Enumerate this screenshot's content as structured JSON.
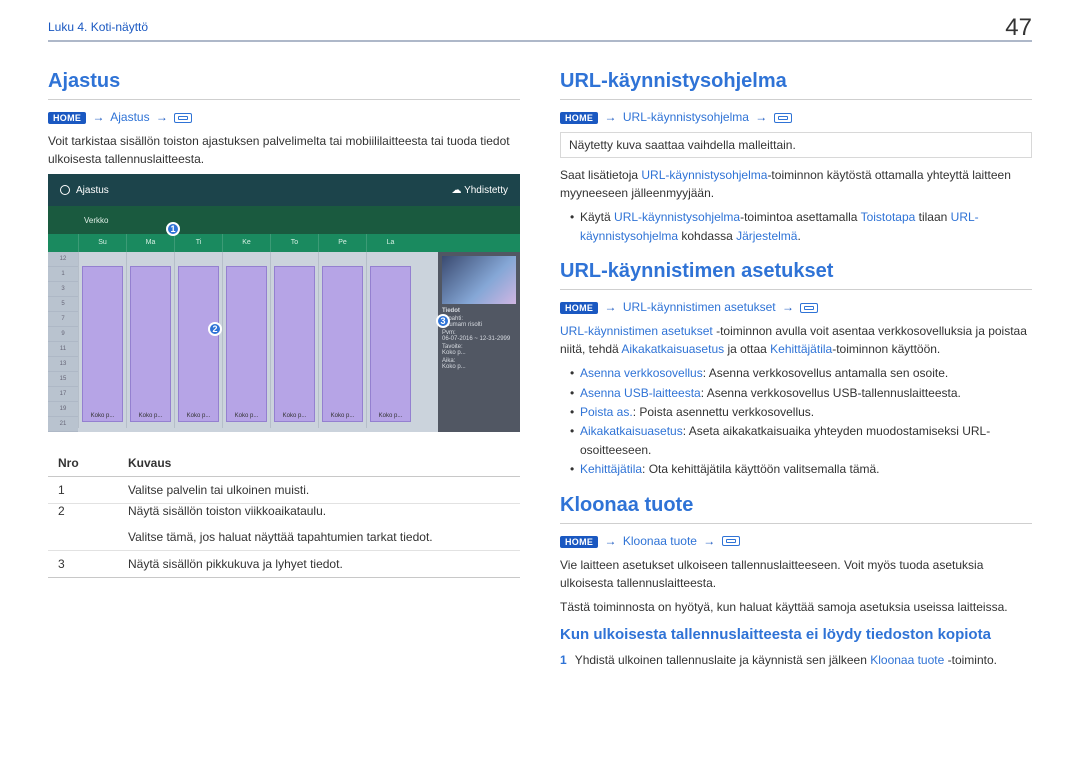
{
  "header": {
    "chapter": "Luku 4. Koti-näyttö",
    "page_number": "47"
  },
  "left": {
    "title": "Ajastus",
    "home_label": "HOME",
    "path_link": "Ajastus",
    "intro": "Voit tarkistaa sisällön toiston ajastuksen palvelimelta tai mobiililaitteesta tai tuoda tiedot ulkoisesta tallennuslaitteesta.",
    "screenshot": {
      "title": "Ajastus",
      "connected": "Yhdistetty",
      "row2_label": "Verkko",
      "days": [
        "",
        "Su",
        "Ma",
        "Ti",
        "Ke",
        "To",
        "Pe",
        "La"
      ],
      "bar_label": "Koko p...",
      "side": {
        "heading": "Tiedot",
        "l1": "Tapahti:",
        "l1v": "Saumarn risolti",
        "l2": "Pvm:",
        "l2v": "06-07-2016 ~ 12-31-2999",
        "l3": "Tavoite:",
        "l3v": "Koko p...",
        "l4": "Aika:",
        "l4v": "Koko p..."
      }
    },
    "table": {
      "th_no": "Nro",
      "th_desc": "Kuvaus",
      "rows": [
        {
          "no": "1",
          "desc": "Valitse palvelin tai ulkoinen muisti."
        },
        {
          "no": "2",
          "desc": "Näytä sisällön toiston viikkoaikataulu."
        },
        {
          "no": "",
          "desc": "Valitse tämä, jos haluat näyttää tapahtumien tarkat tiedot."
        },
        {
          "no": "3",
          "desc": "Näytä sisällön pikkukuva ja lyhyet tiedot."
        }
      ]
    }
  },
  "right": {
    "s1": {
      "title": "URL-käynnistysohjelma",
      "home_label": "HOME",
      "path_link": "URL-käynnistysohjelma",
      "note": "Näytetty kuva saattaa vaihdella malleittain.",
      "p1a": "Saat lisätietoja ",
      "p1b": "URL-käynnistysohjelma",
      "p1c": "-toiminnon käytöstä ottamalla yhteyttä laitteen myyneeseen jälleenmyyjään.",
      "b1a": "Käytä ",
      "b1b": "URL-käynnistysohjelma",
      "b1c": "-toimintoa asettamalla ",
      "b1d": "Toistotapa",
      "b1e": " tilaan ",
      "b1f": "URL-käynnistysohjelma",
      "b1g": " kohdassa ",
      "b1h": "Järjestelmä",
      "b1i": "."
    },
    "s2": {
      "title": "URL-käynnistimen asetukset",
      "home_label": "HOME",
      "path_link": "URL-käynnistimen asetukset",
      "p1a": "URL-käynnistimen asetukset",
      "p1b": " -toiminnon avulla voit asentaa verkkosovelluksia ja poistaa niitä, tehdä ",
      "p1c": "Aikakatkaisuasetus",
      "p1d": " ja ottaa ",
      "p1e": "Kehittäjätila",
      "p1f": "-toiminnon käyttöön.",
      "items": [
        {
          "term": "Asenna verkkosovellus",
          "desc": ": Asenna verkkosovellus antamalla sen osoite."
        },
        {
          "term": "Asenna USB-laitteesta",
          "desc": ": Asenna verkkosovellus USB-tallennuslaitteesta."
        },
        {
          "term": "Poista as.",
          "desc": ": Poista asennettu verkkosovellus."
        },
        {
          "term": "Aikakatkaisuasetus",
          "desc": ": Aseta aikakatkaisuaika yhteyden muodostamiseksi URL-osoitteeseen."
        },
        {
          "term": "Kehittäjätila",
          "desc": ": Ota kehittäjätila käyttöön valitsemalla tämä."
        }
      ]
    },
    "s3": {
      "title": "Kloonaa tuote",
      "home_label": "HOME",
      "path_link": "Kloonaa tuote",
      "p1": "Vie laitteen asetukset ulkoiseen tallennuslaitteeseen. Voit myös tuoda asetuksia ulkoisesta tallennuslaitteesta.",
      "p2": "Tästä toiminnosta on hyötyä, kun haluat käyttää samoja asetuksia useissa laitteissa."
    },
    "s4": {
      "title": "Kun ulkoisesta tallennuslaitteesta ei löydy tiedoston kopiota",
      "step1_num": "1",
      "step1a": "Yhdistä ulkoinen tallennuslaite ja käynnistä sen jälkeen ",
      "step1b": "Kloonaa tuote",
      "step1c": " -toiminto."
    }
  }
}
